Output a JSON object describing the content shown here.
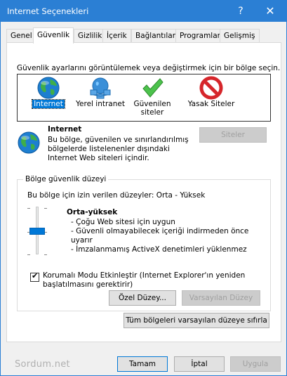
{
  "window": {
    "title": "Internet Seçenekleri"
  },
  "titlebar": {
    "help_glyph": "?",
    "close_glyph": "✕"
  },
  "tabs": [
    {
      "label": "Genel"
    },
    {
      "label": "Güvenlik",
      "active": true
    },
    {
      "label": "Gizlilik"
    },
    {
      "label": "İçerik"
    },
    {
      "label": "Bağlantılar"
    },
    {
      "label": "Programlar"
    },
    {
      "label": "Gelişmiş"
    }
  ],
  "security": {
    "zone_prompt": "Güvenlik ayarlarını görüntülemek veya değiştirmek için bir bölge seçin.",
    "zones": [
      {
        "label": "Internet",
        "icon": "globe-icon",
        "selected": true
      },
      {
        "label": "Yerel intranet",
        "icon": "network-icon"
      },
      {
        "label": "Güvenilen siteler",
        "icon": "check-icon"
      },
      {
        "label": "Yasak Siteler",
        "icon": "forbidden-icon"
      }
    ],
    "selected_zone": {
      "title": "Internet",
      "description": "Bu bölge, güvenilen ve sınırlandırılmış bölgelerde listelenenler dışındaki Internet Web siteleri içindir."
    },
    "sites_button": "Siteler",
    "group_legend": "Bölge güvenlik düzeyi",
    "allowed_levels": "Bu bölge için izin verilen düzeyler: Orta - Yüksek",
    "level": {
      "title": "Orta-yüksek",
      "bullets": [
        "- Çoğu Web sitesi için uygun",
        "- Güvenli olmayabilecek içeriği indirmeden önce uyarır",
        "- İmzalanmamış ActiveX denetimleri yüklenmez"
      ],
      "slider_position": "Orta-yüksek"
    },
    "protected_mode": {
      "label": "Korumalı Modu Etkinleştir (Internet Explorer'ın yeniden başlatılmasını gerektirir)",
      "checked": true
    },
    "custom_level_button": "Özel Düzey...",
    "default_level_button": "Varsayılan Düzey",
    "reset_all_button": "Tüm bölgeleri varsayılan düzeye sıfırla"
  },
  "footer": {
    "watermark": "Sordum.net",
    "ok_button": "Tamam",
    "cancel_button": "İptal",
    "apply_button": "Uygula"
  },
  "colors": {
    "titlebar": "#2b7fd4",
    "accent": "#0078d7",
    "window_bg": "#f0f0f0",
    "panel_bg": "#ffffff"
  }
}
